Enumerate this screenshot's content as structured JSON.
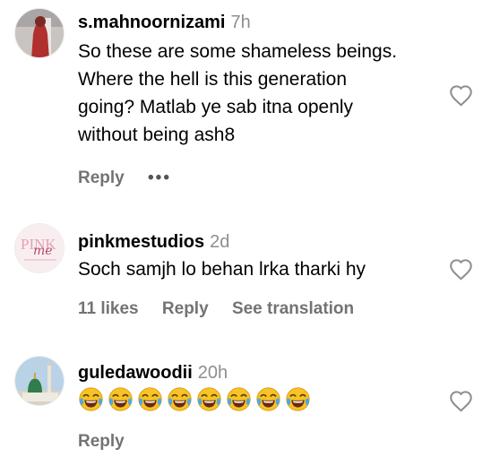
{
  "comments": [
    {
      "username": "s.mahnoornizami",
      "time": "7h",
      "text_lines": [
        "So these are some shameless beings.",
        "Where the hell is this generation",
        "going? Matlab ye sab itna openly",
        "without being ash8"
      ],
      "reply_label": "Reply",
      "more_label": "•••"
    },
    {
      "username": "pinkmestudios",
      "time": "2d",
      "avatar_text": "PINK",
      "avatar_script": "me",
      "text_lines": [
        "Soch samjh lo behan lrka tharki hy"
      ],
      "likes_label": "11 likes",
      "reply_label": "Reply",
      "translation_label": "See translation"
    },
    {
      "username": "guledawoodii",
      "time": "20h",
      "emoji_count": 8,
      "emoji_name": "face-with-tears-of-joy",
      "reply_label": "Reply"
    }
  ],
  "colors": {
    "secondary_text": "#737373",
    "timestamp": "#8e8e8e",
    "emoji_face": "#f7c325",
    "emoji_tear": "#4aa8e8",
    "pink_brand": "#e8a0b4"
  },
  "icons": {
    "like": "heart-outline-icon"
  }
}
